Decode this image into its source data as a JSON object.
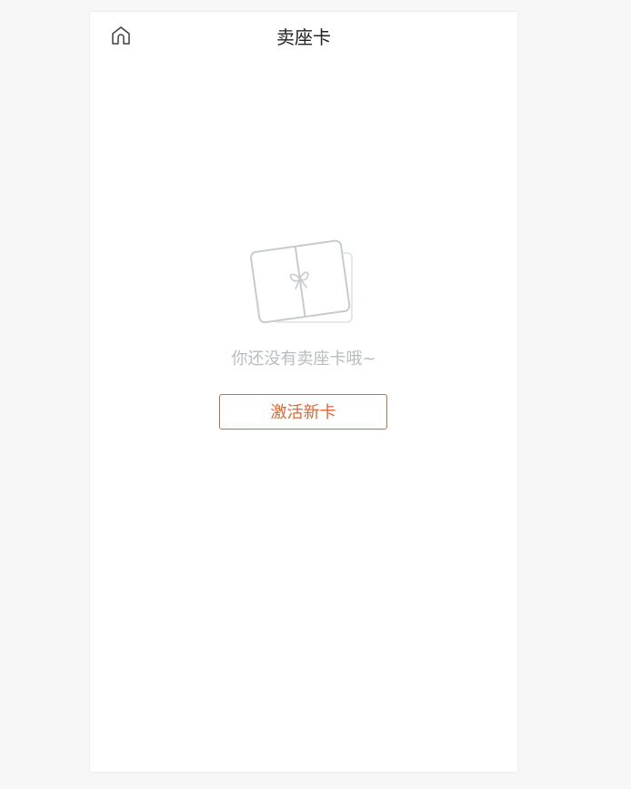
{
  "header": {
    "title": "卖座卡",
    "home_icon": "home-icon"
  },
  "empty_state": {
    "illustration_icon": "gift-card-icon",
    "message": "你还没有卖座卡哦~"
  },
  "actions": {
    "activate_label": "激活新卡"
  },
  "colors": {
    "accent": "#e06633",
    "muted_text": "#b8bcc0",
    "title_text": "#222222",
    "page_bg": "#f7f7f7",
    "panel_bg": "#ffffff"
  }
}
